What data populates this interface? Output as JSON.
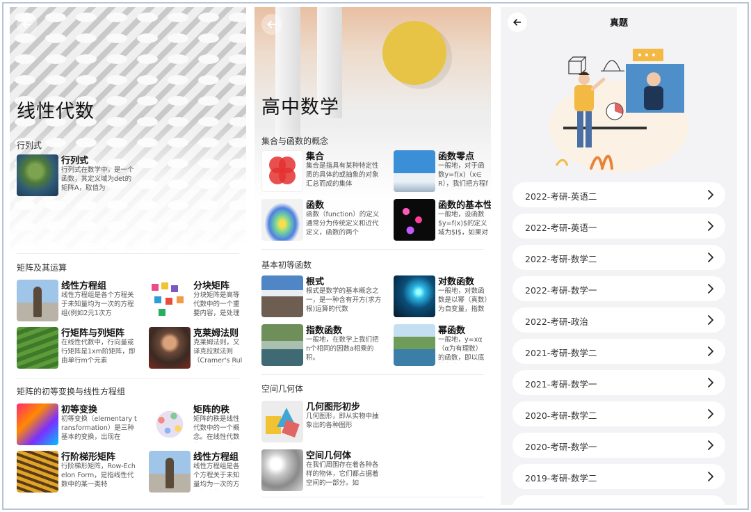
{
  "panel1": {
    "title": "线性代数",
    "sections": [
      {
        "title": "行列式",
        "cards": [
          {
            "title": "行列式",
            "desc": "行列式在数学中，是一个函数，其定义域为det的矩阵A，取值为",
            "icon": "earth-photo-icon"
          }
        ]
      },
      {
        "title": "矩阵及其运算",
        "cards": [
          {
            "title": "线性方程组",
            "desc": "线性方程组是各个方程关于未知量均为一次的方程组(例如2元1次方",
            "icon": "statue-photo-icon"
          },
          {
            "title": "分块矩阵",
            "desc": "分块矩阵是高等代数中的一个重要内容，是处理阶数较高的",
            "icon": "color-blocks-icon"
          },
          {
            "title": "行矩阵与列矩阵",
            "desc": "在线性代数中，行向量或行矩阵是1xm阶矩阵，即由单行m个元素",
            "icon": "field-photo-icon"
          },
          {
            "title": "克莱姆法则",
            "desc": "克莱姆法则，又译克拉默法则（Cramer's Rule）是线性代数",
            "icon": "portrait-icon"
          }
        ]
      },
      {
        "title": "矩阵的初等变换与线性方程组",
        "cards": [
          {
            "title": "初等变换",
            "desc": "初等变换（elementary transformation）是三种基本的变换，出现在",
            "icon": "color-cube-icon"
          },
          {
            "title": "矩阵的秩",
            "desc": "矩阵的秩是线性代数中的一个概念。在线性代数中，一个矩阵",
            "icon": "dots-cluster-icon"
          },
          {
            "title": "行阶梯形矩阵",
            "desc": "行阶梯形矩阵，Row-Echelon Form，是指线性代数中的某一类特",
            "icon": "terraces-photo-icon"
          },
          {
            "title": "线性方程组",
            "desc": "线性方程组是各个方程关于未知量均为一次的方程组(例如2元",
            "icon": "statue-photo-icon"
          }
        ]
      }
    ]
  },
  "panel2": {
    "title": "高中数学",
    "sections": [
      {
        "title": "集合与函数的概念",
        "cards": [
          {
            "title": "集合",
            "desc": "集合是指具有某种特定性质的具体的或抽象的对象汇总而成的集体",
            "icon": "venn-circles-icon"
          },
          {
            "title": "函数零点",
            "desc": "一般地，对于函数y=f(x)（x∈R），我们把方程f(x)=0的",
            "icon": "airplane-photo-icon"
          },
          {
            "title": "函数",
            "desc": "函数（function）的定义通常分为传统定义和近代定义，函数的两个",
            "icon": "surface-plot-icon"
          },
          {
            "title": "函数的基本性质",
            "desc": "一般地，设函数$y=f(x)$的定义域为$I$，如果对于",
            "icon": "glow-dots-icon"
          }
        ]
      },
      {
        "title": "基本初等函数",
        "cards": [
          {
            "title": "根式",
            "desc": "根式是数学的基本概念之一，是一种含有开方(求方根)运算的代数",
            "icon": "mountain-photo-icon"
          },
          {
            "title": "对数函数",
            "desc": "一般地，对数函数是以幂（真数）为自变量，指数为因变量",
            "icon": "particles-photo-icon"
          },
          {
            "title": "指数函数",
            "desc": "一般地，在数学上我们把n个相同的因数a相乘的积。",
            "icon": "river-photo-icon"
          },
          {
            "title": "幂函数",
            "desc": "一般地，y=xα（α为有理数）的函数，即以底数为自变量，幂",
            "icon": "lake-photo-icon"
          }
        ]
      },
      {
        "title": "空间几何体",
        "cards": [
          {
            "title": "几何图形初步",
            "desc": "几何图形，即从实物中抽象出的各种图形",
            "icon": "shapes-3d-icon"
          },
          {
            "title": "空间几何体",
            "desc": "在我们周围存在着各种各样的物体，它们都占据着空间的一部分。如",
            "icon": "solids-photo-icon"
          }
        ]
      }
    ]
  },
  "panel3": {
    "title": "真题",
    "items": [
      "2022-考研-英语二",
      "2022-考研-英语一",
      "2022-考研-数学二",
      "2022-考研-数学一",
      "2022-考研-政治",
      "2021-考研-数学二",
      "2021-考研-数学一",
      "2020-考研-数学二",
      "2020-考研-数学一",
      "2019-考研-数学二"
    ]
  }
}
